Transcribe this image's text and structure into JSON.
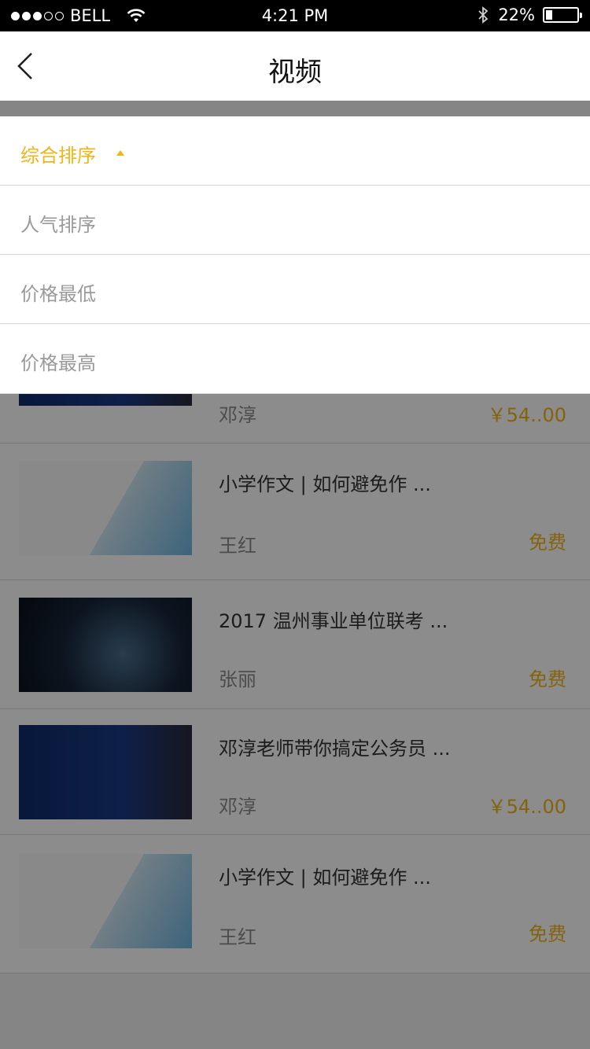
{
  "status_bar": {
    "carrier": "BELL",
    "time": "4:21 PM",
    "battery": "22%",
    "battery_level": 0.22
  },
  "nav": {
    "title": "视频"
  },
  "sort_menu": {
    "options": [
      {
        "label": "综合排序",
        "active": true
      },
      {
        "label": "人气排序",
        "active": false
      },
      {
        "label": "价格最低",
        "active": false
      },
      {
        "label": "价格最高",
        "active": false
      }
    ]
  },
  "videos": [
    {
      "title": "",
      "author": "邓淳",
      "price": "￥54..00",
      "thumb": "teacher"
    },
    {
      "title": "小学作文 | 如何避免作 ...",
      "author": "王红",
      "price": "免费",
      "thumb": "book"
    },
    {
      "title": "2017 温州事业单位联考 ...",
      "author": "张丽",
      "price": "免费",
      "thumb": "java"
    },
    {
      "title": "邓淳老师带你搞定公务员 ...",
      "author": "邓淳",
      "price": "￥54..00",
      "thumb": "teacher"
    },
    {
      "title": "小学作文 | 如何避免作 ...",
      "author": "王红",
      "price": "免费",
      "thumb": "book"
    }
  ],
  "colors": {
    "accent": "#f2b418",
    "overlay": "rgba(0,0,0,0.45)"
  }
}
